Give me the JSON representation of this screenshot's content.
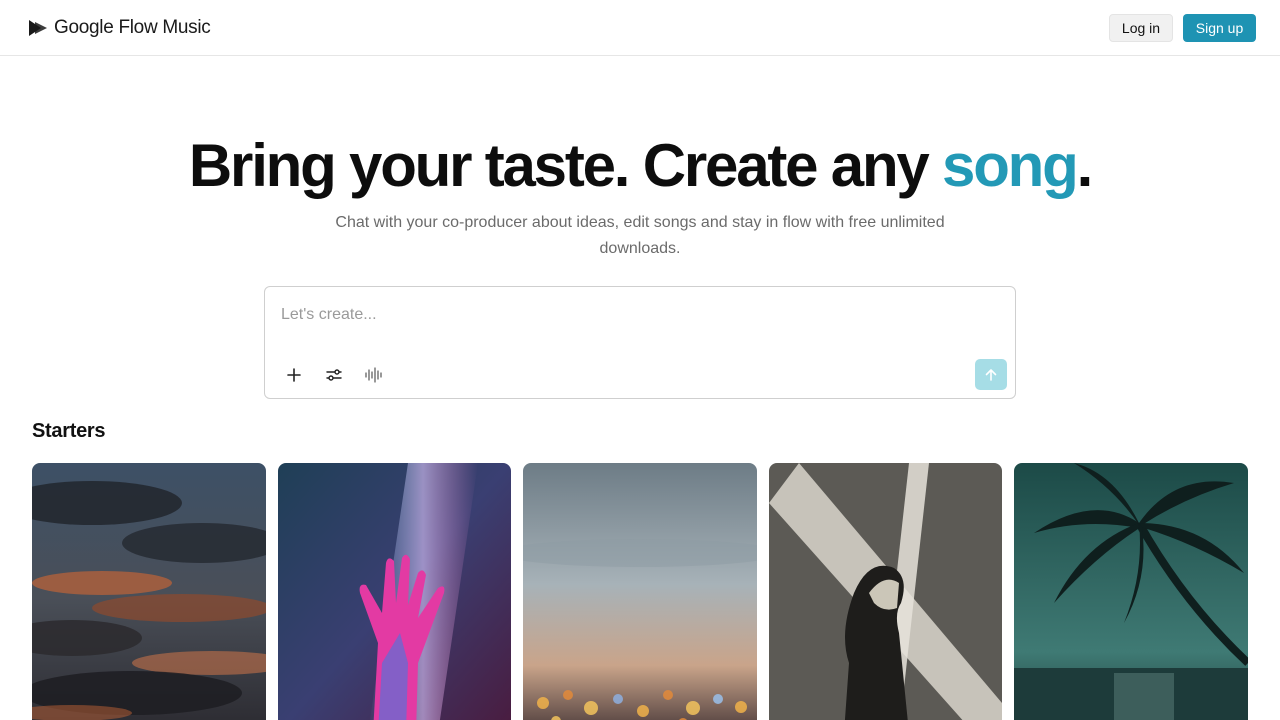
{
  "header": {
    "brand": "Google Flow Music",
    "login_label": "Log in",
    "signup_label": "Sign up"
  },
  "hero": {
    "title_main": "Bring your taste. Create any ",
    "title_accent": "song",
    "title_end": ".",
    "subtitle": "Chat with your co-producer about ideas, edit songs and stay in flow with free unlimited downloads."
  },
  "prompt": {
    "placeholder": "Let's create...",
    "value": "",
    "tools": [
      "plus-icon",
      "sliders-icon",
      "waveform-icon"
    ],
    "send_icon": "arrow-up-icon"
  },
  "starters": {
    "title": "Starters",
    "cards": [
      {
        "image": "sunset-clouds"
      },
      {
        "image": "neon-hand"
      },
      {
        "image": "city-bokeh-dusk"
      },
      {
        "image": "woman-light-beam"
      },
      {
        "image": "palm-tree-night-sea"
      }
    ]
  },
  "colors": {
    "accent": "#2399b6",
    "signup_bg": "#1e93b3",
    "send_bg": "#a6dde6"
  }
}
